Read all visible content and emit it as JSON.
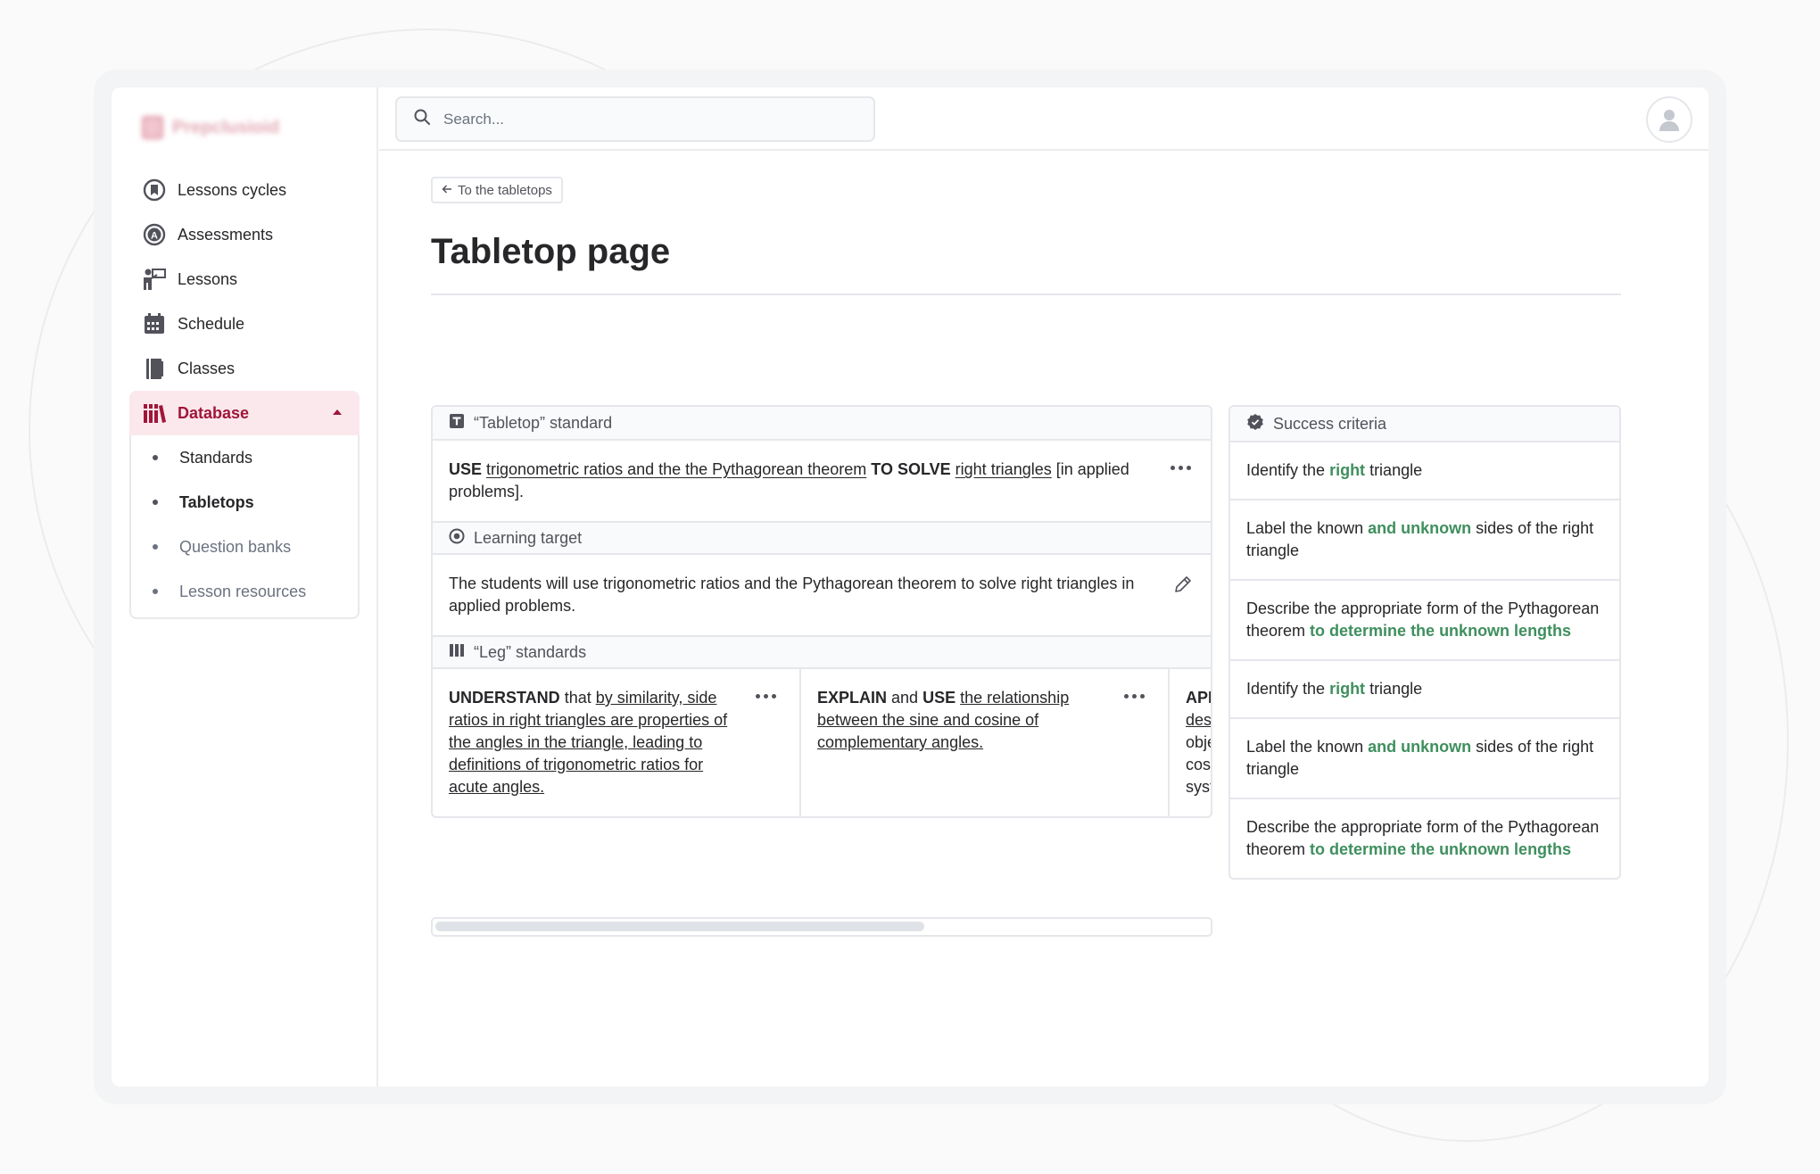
{
  "sidebar": {
    "logo": "Prepclusioid",
    "nav": [
      {
        "label": "Lessons cycles",
        "icon": "lesson-cycles-icon"
      },
      {
        "label": "Assessments",
        "icon": "assessments-icon"
      },
      {
        "label": "Lessons",
        "icon": "lessons-icon"
      },
      {
        "label": "Schedule",
        "icon": "calendar-icon"
      },
      {
        "label": "Classes",
        "icon": "classes-icon"
      },
      {
        "label": "Database",
        "icon": "database-icon"
      }
    ],
    "database_sub": [
      {
        "label": "Standards"
      },
      {
        "label": "Tabletops"
      },
      {
        "label": "Question banks"
      },
      {
        "label": "Lesson resources"
      }
    ]
  },
  "topbar": {
    "search_placeholder": "Search...",
    "avatar": "user-avatar-icon"
  },
  "page": {
    "back_label": "To the tabletops",
    "title": "Tabletop page"
  },
  "tabletop": {
    "standard_header": "“Tabletop” standard",
    "standard": {
      "v1": "USE",
      "p1": "trigonometric ratios and the the Pythagorean theorem",
      "v2": "TO SOLVE",
      "p2": "right triangles",
      "tail": "[in applied problems]."
    },
    "learning_header": "Learning target",
    "learning_text": "The students will use trigonometric ratios and the Pythagorean theorem to solve right triangles in applied problems.",
    "leg_header": "“Leg” standards",
    "legs": [
      {
        "v1": "UNDERSTAND",
        "t1": "that",
        "u1": "by similarity, side ratios in right triangles are properties of the angles in the triangle, leading to definitions of trigonometric ratios for acute angles."
      },
      {
        "v1": "EXPLAIN",
        "t1": "and",
        "v2": "USE",
        "u1": "the relationship between the sine and cosine of complementary angles."
      },
      {
        "v1": "APPLY",
        "t1": "",
        "u1": "des",
        "lines": [
          "obje",
          "cos",
          "syst"
        ]
      }
    ]
  },
  "criteria": {
    "header": "Success criteria",
    "items": [
      {
        "a": "Identify the ",
        "g": "right",
        "b": " triangle"
      },
      {
        "a": "Label the known ",
        "g": "and unknown",
        "b": " sides of the right triangle"
      },
      {
        "a": "Describe the appropriate form of the Pythagorean theorem ",
        "g": "to determine the unknown lengths",
        "b": ""
      },
      {
        "a": "Identify the ",
        "g": "right",
        "b": " triangle"
      },
      {
        "a": "Label the known ",
        "g": "and unknown",
        "b": " sides of the right triangle"
      },
      {
        "a": "Describe the appropriate form of the Pythagorean theorem ",
        "g": "to determine the unknown lengths",
        "b": ""
      }
    ]
  },
  "colors": {
    "accent": "#a01639",
    "accent_bg": "#fbe8ec",
    "criteria_green": "#3f8f5e"
  }
}
